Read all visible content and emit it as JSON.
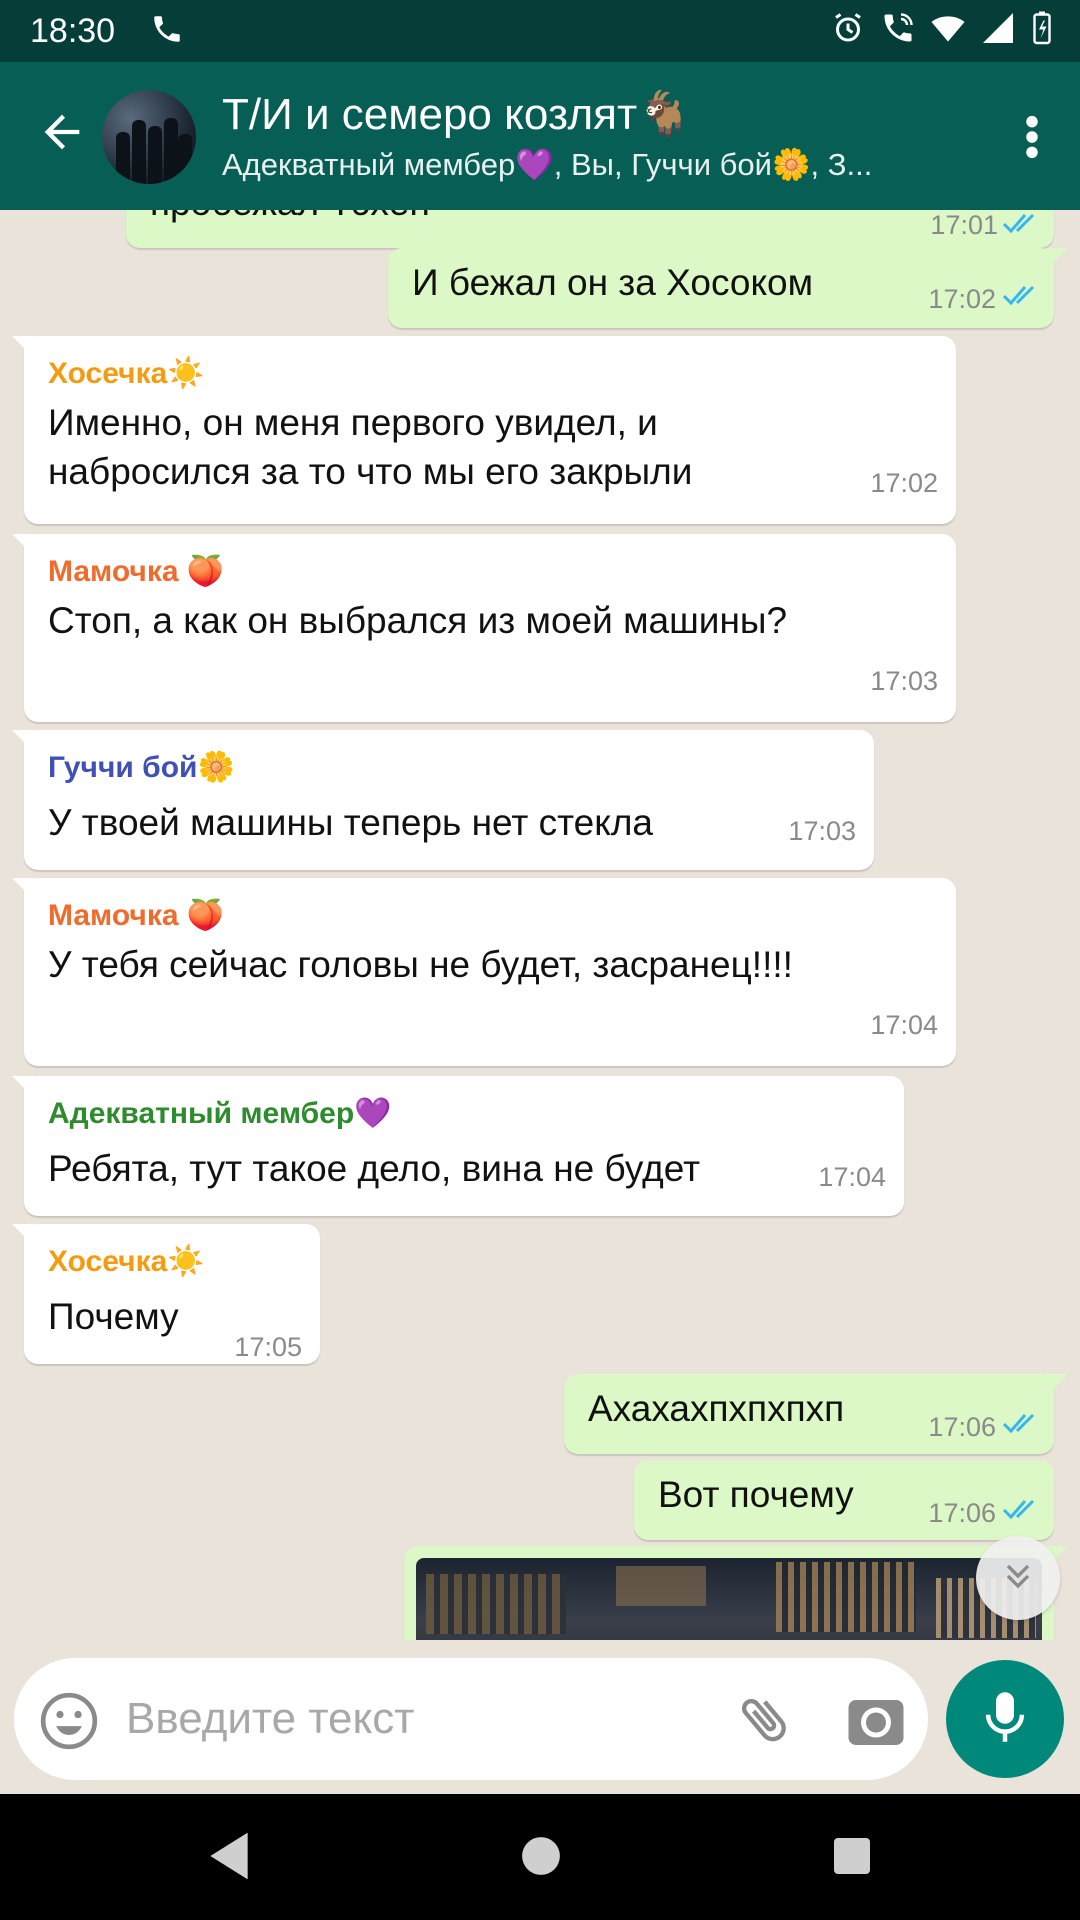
{
  "status_bar": {
    "time": "18:30"
  },
  "header": {
    "title": "Т/И и семеро козлят🐐",
    "subtitle": "Адекватный мембер💜, Вы, Гуччи бой🌼, З..."
  },
  "messages": [
    {
      "direction": "out",
      "text": "пробежал Тэхён",
      "time": "17:01",
      "read": true
    },
    {
      "direction": "out",
      "text": "И бежал он за Хосоком",
      "time": "17:02",
      "read": true
    },
    {
      "direction": "in",
      "sender": "Хосечка☀️",
      "sender_color": "#f39c12",
      "lines": [
        "Именно, он меня первого увидел, и",
        "набросился за то что мы его закрыли"
      ],
      "time": "17:02"
    },
    {
      "direction": "in",
      "sender": "Мамочка 🍑",
      "sender_color": "#ef6c2d",
      "lines": [
        "Стоп, а как он выбрался из моей машины?"
      ],
      "time": "17:03"
    },
    {
      "direction": "in",
      "sender": "Гуччи бой🌼",
      "sender_color": "#3f51b5",
      "lines": [
        "У твоей машины теперь нет стекла"
      ],
      "time": "17:03"
    },
    {
      "direction": "in",
      "sender": "Мамочка 🍑",
      "sender_color": "#ef6c2d",
      "lines": [
        "У тебя сейчас головы не будет, засранец!!!!"
      ],
      "time": "17:04"
    },
    {
      "direction": "in",
      "sender": "Адекватный мембер💜",
      "sender_color": "#2e8b2e",
      "lines": [
        "Ребята, тут такое дело, вина не будет"
      ],
      "time": "17:04"
    },
    {
      "direction": "in",
      "sender": "Хосечка☀️",
      "sender_color": "#f39c12",
      "lines": [
        "Почему"
      ],
      "time": "17:05"
    },
    {
      "direction": "out",
      "text": "Ахахахпхпхпхп",
      "time": "17:06",
      "read": true
    },
    {
      "direction": "out",
      "text": "Вот почему",
      "time": "17:06",
      "read": true
    }
  ],
  "input": {
    "placeholder": "Введите текст"
  },
  "icons": {
    "back": "arrow-left-icon",
    "menu": "more-vert-icon",
    "emoji": "emoji-icon",
    "attach": "paperclip-icon",
    "camera": "camera-icon",
    "mic": "microphone-icon",
    "scroll": "chevron-double-down-icon"
  },
  "colors": {
    "app_bar": "#075e54",
    "status_bar": "#053e38",
    "outgoing": "#dcf8c6",
    "incoming": "#ffffff",
    "accent": "#00897b",
    "read_ticks": "#34b7f1"
  }
}
